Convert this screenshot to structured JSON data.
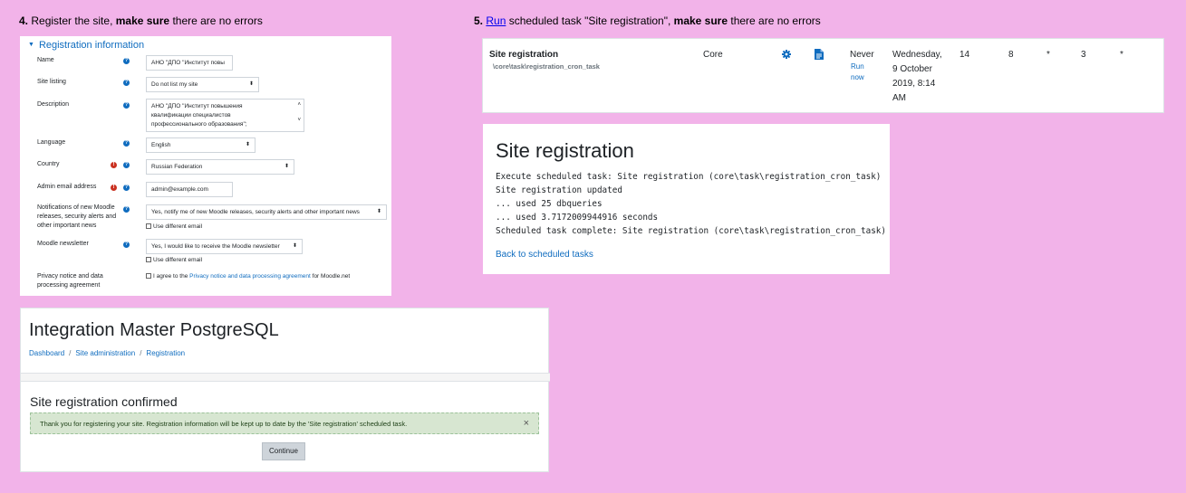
{
  "step4": {
    "number": "4.",
    "text_a": "Register the site, ",
    "bold": "make sure",
    "text_b": " there are no errors"
  },
  "step5": {
    "number": "5.",
    "link": "Run",
    "text_a": " scheduled task \"Site registration\", ",
    "bold": "make sure",
    "text_b": " there are no errors"
  },
  "form": {
    "section_title": "Registration information",
    "fields": {
      "name": {
        "label": "Name",
        "value": "АНО \"ДПО \"Институт повы"
      },
      "listing": {
        "label": "Site listing",
        "value": "Do not list my site"
      },
      "description": {
        "label": "Description",
        "lines": [
          "АНО \"ДПО \"Институт повышения",
          "квалификации специалистов",
          "профессионального образования\";"
        ]
      },
      "language": {
        "label": "Language",
        "value": "English"
      },
      "country": {
        "label": "Country",
        "value": "Russian Federation"
      },
      "admin_email": {
        "label": "Admin email address",
        "value": "admin@example.com"
      },
      "notifications": {
        "label_lines": [
          "Notifications of new Moodle",
          "releases, security alerts and",
          "other important news"
        ],
        "value": "Yes, notify me of new Moodle releases, security alerts and other important news",
        "checkbox": "Use different email"
      },
      "newsletter": {
        "label": "Moodle newsletter",
        "value": "Yes, I would like to receive the Moodle newsletter",
        "checkbox": "Use different email"
      },
      "privacy": {
        "label_lines": [
          "Privacy notice and data",
          "processing agreement"
        ],
        "agree_prefix": "I agree to the ",
        "agree_link": "Privacy notice and data processing agreement",
        "agree_suffix": " for Moodle.net"
      }
    }
  },
  "integration": {
    "title": "Integration Master PostgreSQL",
    "breadcrumbs": [
      "Dashboard",
      "Site administration",
      "Registration"
    ],
    "confirmed_heading": "Site registration confirmed",
    "alert": "Thank you for registering your site. Registration information will be kept up to date by the 'Site registration' scheduled task.",
    "close_symbol": "×",
    "continue_label": "Continue"
  },
  "task": {
    "name": "Site registration",
    "classname": "\\core\\task\\registration_cron_task",
    "component": "Core",
    "last_run": "Never",
    "run_now_lines": [
      "Run",
      "now"
    ],
    "next_run_lines": [
      "Wednesday,",
      "9 October",
      "2019, 8:14",
      "AM"
    ],
    "minute": "14",
    "hour": "8",
    "day": "*",
    "day_of_week": "3",
    "month": "*"
  },
  "log": {
    "title": "Site registration",
    "lines": [
      "Execute scheduled task: Site registration (core\\task\\registration_cron_task)",
      "Site registration updated",
      "... used 25 dbqueries",
      "... used 3.7172009944916 seconds",
      "Scheduled task complete: Site registration (core\\task\\registration_cron_task)"
    ],
    "back_link": "Back to scheduled tasks"
  },
  "colors": {
    "background": "#f2b3e9",
    "link": "#0f6cbf",
    "alert_bg": "#d7e6d1"
  },
  "icons": [
    "question-icon",
    "error-icon",
    "gear-icon",
    "document-icon",
    "chevron-down-icon",
    "close-icon"
  ]
}
